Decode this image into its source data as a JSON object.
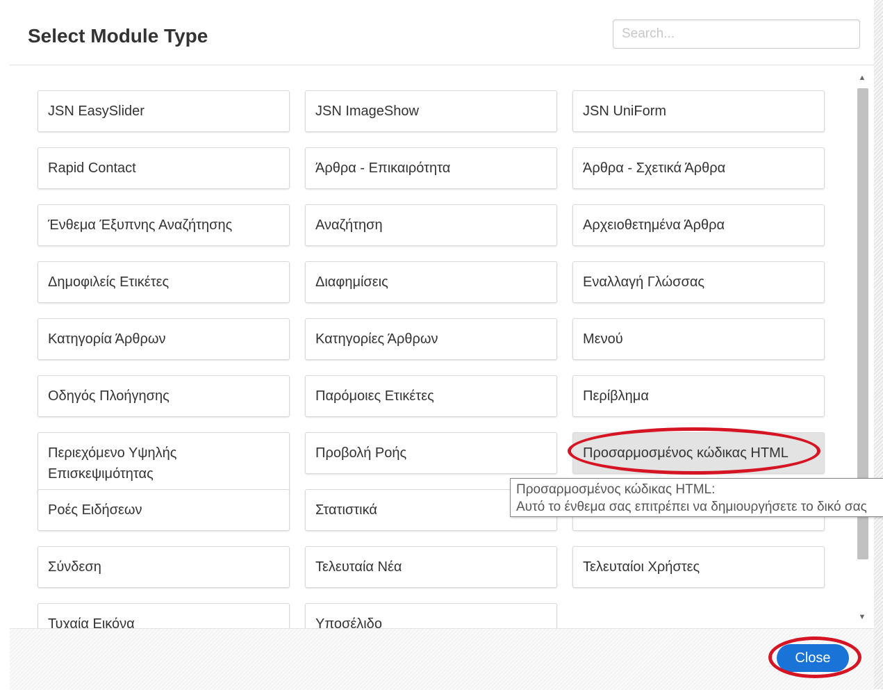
{
  "header": {
    "title": "Select Module Type",
    "search_placeholder": "Search..."
  },
  "modules": [
    {
      "label": "JSN EasySlider"
    },
    {
      "label": "JSN ImageShow"
    },
    {
      "label": "JSN UniForm"
    },
    {
      "label": "Rapid Contact"
    },
    {
      "label": "Άρθρα - Επικαιρότητα"
    },
    {
      "label": "Άρθρα - Σχετικά Άρθρα"
    },
    {
      "label": "Ένθεμα Έξυπνης Αναζήτησης"
    },
    {
      "label": "Αναζήτηση"
    },
    {
      "label": "Αρχειοθετημένα Άρθρα"
    },
    {
      "label": "Δημοφιλείς Ετικέτες"
    },
    {
      "label": "Διαφημίσεις"
    },
    {
      "label": "Εναλλαγή Γλώσσας"
    },
    {
      "label": "Κατηγορία Άρθρων"
    },
    {
      "label": "Κατηγορίες Άρθρων"
    },
    {
      "label": "Μενού"
    },
    {
      "label": "Οδηγός Πλοήγησης"
    },
    {
      "label": "Παρόμοιες Ετικέτες"
    },
    {
      "label": "Περίβλημα"
    },
    {
      "label": "Περιεχόμενο Υψηλής Επισκεψιμότητας"
    },
    {
      "label": "Προβολή Ροής"
    },
    {
      "label": "Προσαρμοσμένος κώδικας HTML"
    },
    {
      "label": "Ροές Ειδήσεων"
    },
    {
      "label": "Στατιστικά"
    },
    {
      "label": ""
    },
    {
      "label": "Σύνδεση"
    },
    {
      "label": "Τελευταία Νέα"
    },
    {
      "label": "Τελευταίοι Χρήστες"
    },
    {
      "label": "Τυχαία Εικόνα"
    },
    {
      "label": "Υποσέλιδο"
    }
  ],
  "tooltip": {
    "line1": "Προσαρμοσμένος κώδικας HTML:",
    "line2": "Αυτό το ένθεμα σας επιτρέπει να δημιουργήσετε το δικό σας"
  },
  "footer": {
    "close_label": "Close"
  },
  "colors": {
    "close_button": "#1a74d8",
    "annotation": "#d51424",
    "hovered_module": "#e3e3e3"
  }
}
